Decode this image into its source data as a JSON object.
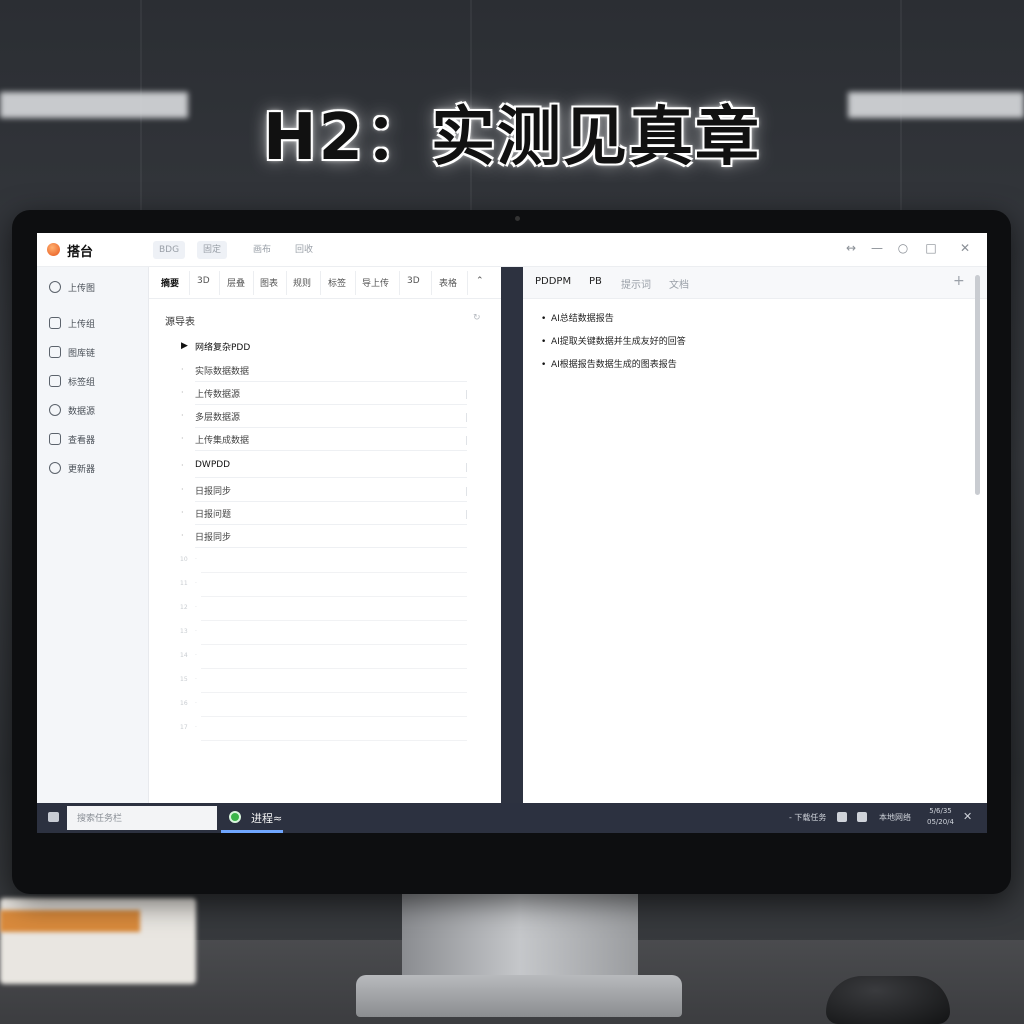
{
  "headline": "H2：实测见真章",
  "app": {
    "title": "搭台",
    "tabs": [
      "BDG",
      "固定",
      "画布",
      "回收"
    ],
    "window_buttons": [
      "↔",
      "—",
      "○",
      "□",
      "✕"
    ]
  },
  "sidebar": {
    "items": [
      {
        "label": "上传图",
        "icon": "circle-icon"
      },
      {
        "label": "上传组",
        "icon": "home-icon"
      },
      {
        "label": "图库链",
        "icon": "box-icon"
      },
      {
        "label": "标签组",
        "icon": "box-icon"
      },
      {
        "label": "数据源",
        "icon": "clock-icon"
      },
      {
        "label": "查看器",
        "icon": "lock-icon"
      },
      {
        "label": "更新器",
        "icon": "refresh-icon"
      }
    ]
  },
  "middle": {
    "tabs": [
      "摘要",
      "3D",
      "层叠",
      "图表",
      "规则",
      "标签",
      "导上传",
      "3D",
      "表格",
      "⌃"
    ],
    "list_title": "源导表",
    "list_title_action": "↻",
    "rows": [
      {
        "text": "网络复杂PDD",
        "strong": true,
        "bullet": "▶"
      },
      {
        "text": "实际数据数据",
        "strong": false,
        "bullet": "·"
      },
      {
        "text": "上传数据源",
        "strong": false,
        "bullet": "·"
      },
      {
        "text": "多层数据源",
        "strong": false,
        "bullet": "·"
      },
      {
        "text": "上传集成数据",
        "strong": false,
        "bullet": "·"
      },
      {
        "text": "DWPDD",
        "strong": true,
        "bullet": "·"
      },
      {
        "text": "日报同步",
        "strong": false,
        "bullet": "·"
      },
      {
        "text": "日报问题",
        "strong": false,
        "bullet": "·"
      },
      {
        "text": "日报同步",
        "strong": false,
        "bullet": "·"
      }
    ],
    "empty_rows": [
      "10",
      "11",
      "12",
      "13",
      "14",
      "15",
      "16",
      "17"
    ]
  },
  "right": {
    "tabs": [
      "PDDPM",
      "PB",
      "提示词",
      "文档"
    ],
    "notes": [
      "AI总结数据报告",
      "AI提取关键数据并生成友好的回答",
      "AI根据报告数据生成的图表报告"
    ]
  },
  "taskbar": {
    "search_placeholder": "搜索任务栏",
    "app_label": "进程≈",
    "tray_text_1": "- 下载任务",
    "tray_text_2": "本地网络",
    "clock_time": "5/6/35",
    "clock_date": "05/20/4"
  },
  "colors": {
    "accent_orange": "#e7561b",
    "divider": "#2d3240",
    "taskbar": "#2c3140",
    "active_underline": "#6fa6ff",
    "app_icon_green": "#3bb54a"
  }
}
